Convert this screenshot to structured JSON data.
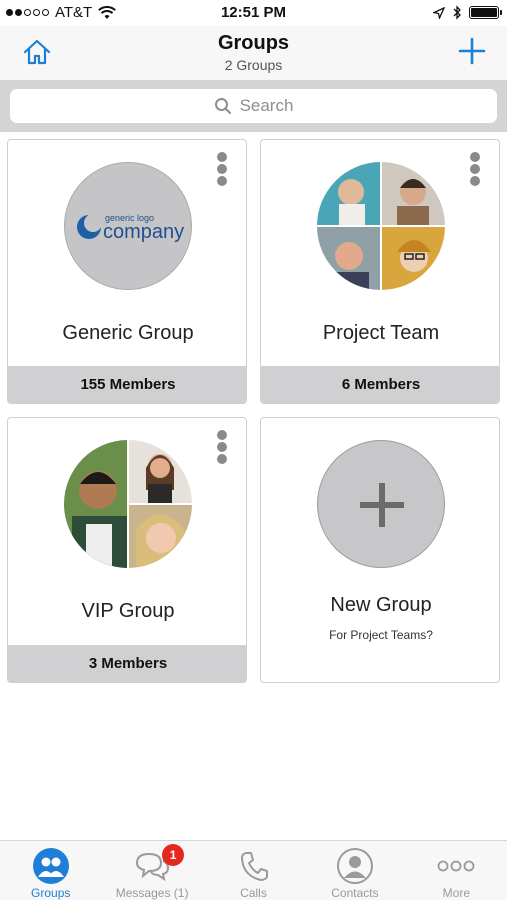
{
  "status_bar": {
    "carrier": "AT&T",
    "time": "12:51 PM"
  },
  "nav": {
    "title": "Groups",
    "subtitle": "2 Groups"
  },
  "search": {
    "placeholder": "Search"
  },
  "groups": [
    {
      "name": "Generic Group",
      "members": "155 Members",
      "logo_small": "generic logo",
      "logo_big": "company"
    },
    {
      "name": "Project Team",
      "members": "6 Members"
    },
    {
      "name": "VIP Group",
      "members": "3 Members"
    }
  ],
  "new_group": {
    "title": "New Group",
    "subtitle": "For Project Teams?"
  },
  "tabbar": {
    "tabs": [
      {
        "label": "Groups",
        "icon": "groups-icon",
        "active": true
      },
      {
        "label": "Messages (1)",
        "icon": "messages-icon",
        "badge": "1"
      },
      {
        "label": "Calls",
        "icon": "phone-icon"
      },
      {
        "label": "Contacts",
        "icon": "contact-icon"
      },
      {
        "label": "More",
        "icon": "more-icon"
      }
    ]
  },
  "colors": {
    "accent": "#1e7fd6",
    "badge": "#e4281f",
    "footer": "#d0d0d2"
  }
}
